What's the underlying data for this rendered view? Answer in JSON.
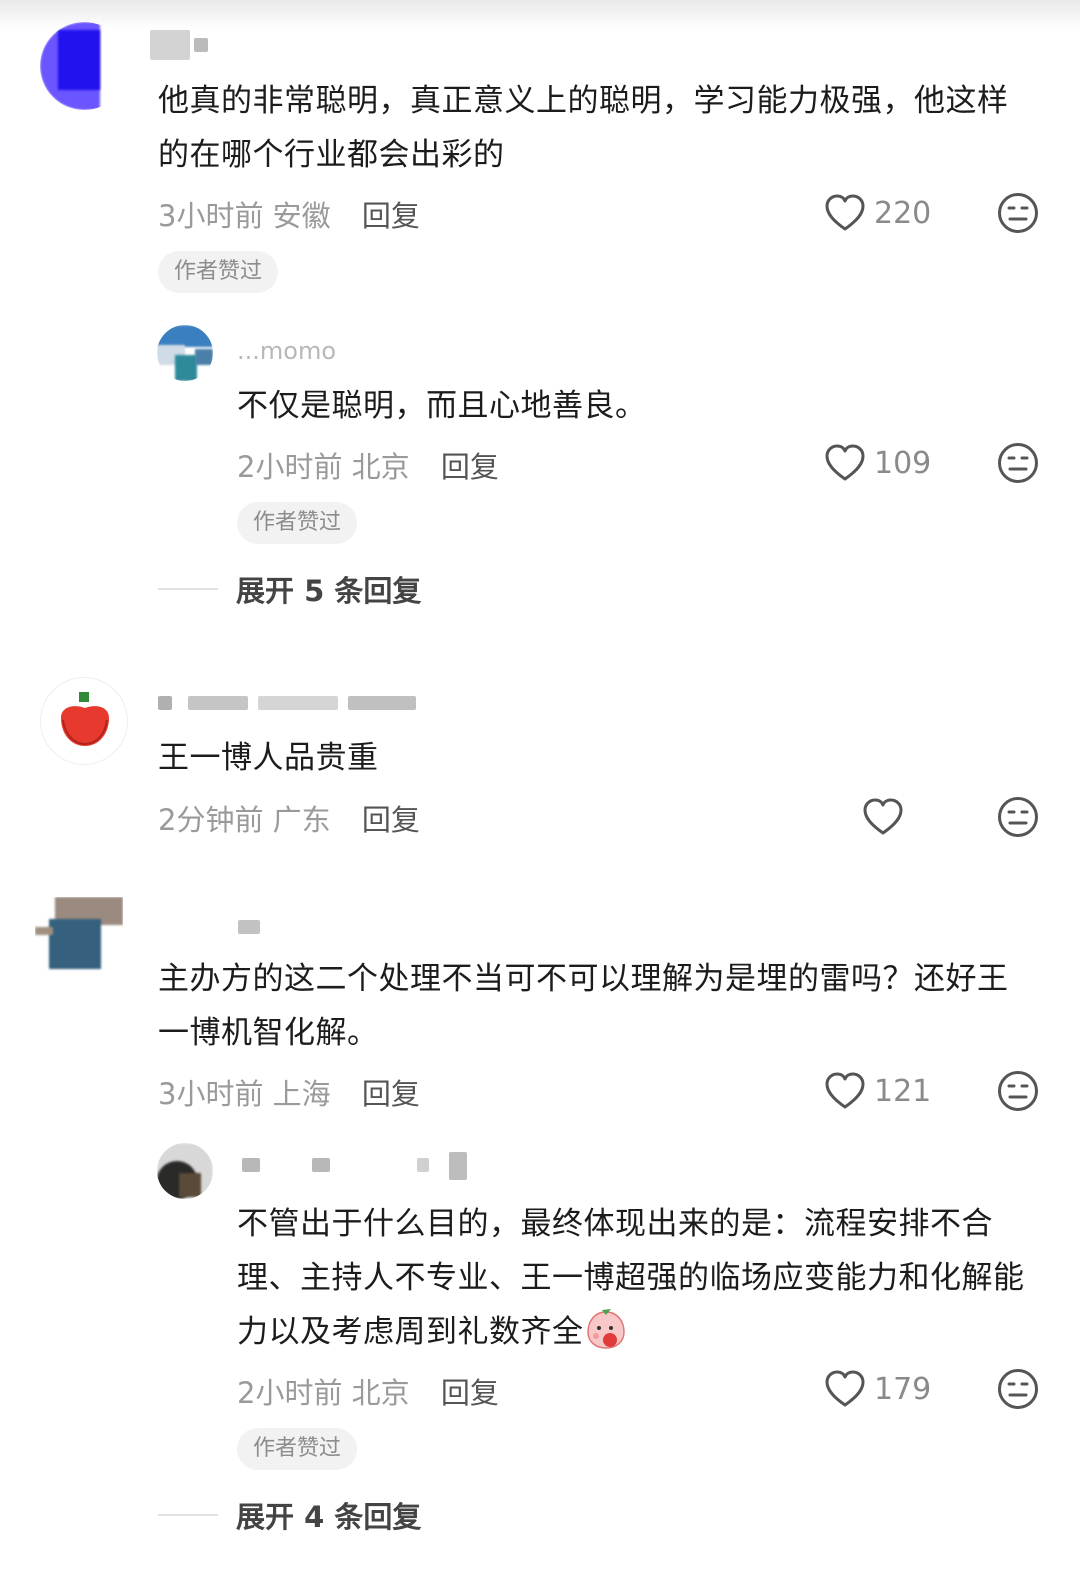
{
  "comments": [
    {
      "text": "他真的非常聪明，真正意义上的聪明，学习能力极强，他这样的在哪个行业都会出彩的",
      "time": "3小时前",
      "location": "安徽",
      "reply_label": "回复",
      "likes": "220",
      "badge": "作者赞过",
      "replies": [
        {
          "username": "...momo",
          "text": "不仅是聪明，而且心地善良。",
          "time": "2小时前",
          "location": "北京",
          "reply_label": "回复",
          "likes": "109",
          "badge": "作者赞过"
        }
      ],
      "expand_label": "展开 5 条回复"
    },
    {
      "text": "王一博人品贵重",
      "time": "2分钟前",
      "location": "广东",
      "reply_label": "回复",
      "likes": ""
    },
    {
      "text": "主办方的这二个处理不当可不可以理解为是埋的雷吗？还好王一博机智化解。",
      "time": "3小时前",
      "location": "上海",
      "reply_label": "回复",
      "likes": "121",
      "replies": [
        {
          "text": "不管出于什么目的，最终体现出来的是：流程安排不合理、主持人不专业、王一博超强的临场应变能力和化解能力以及考虑周到礼数齐全",
          "time": "2小时前",
          "location": "北京",
          "reply_label": "回复",
          "likes": "179",
          "badge": "作者赞过"
        }
      ],
      "expand_label": "展开 4 条回复"
    }
  ],
  "icons": {
    "like": "heart-outline-icon",
    "dislike": "neutral-face-icon",
    "sticker": "peach-face-sticker"
  },
  "colors": {
    "meta": "#9a9a9a",
    "badge_bg": "#f2f2f2"
  }
}
